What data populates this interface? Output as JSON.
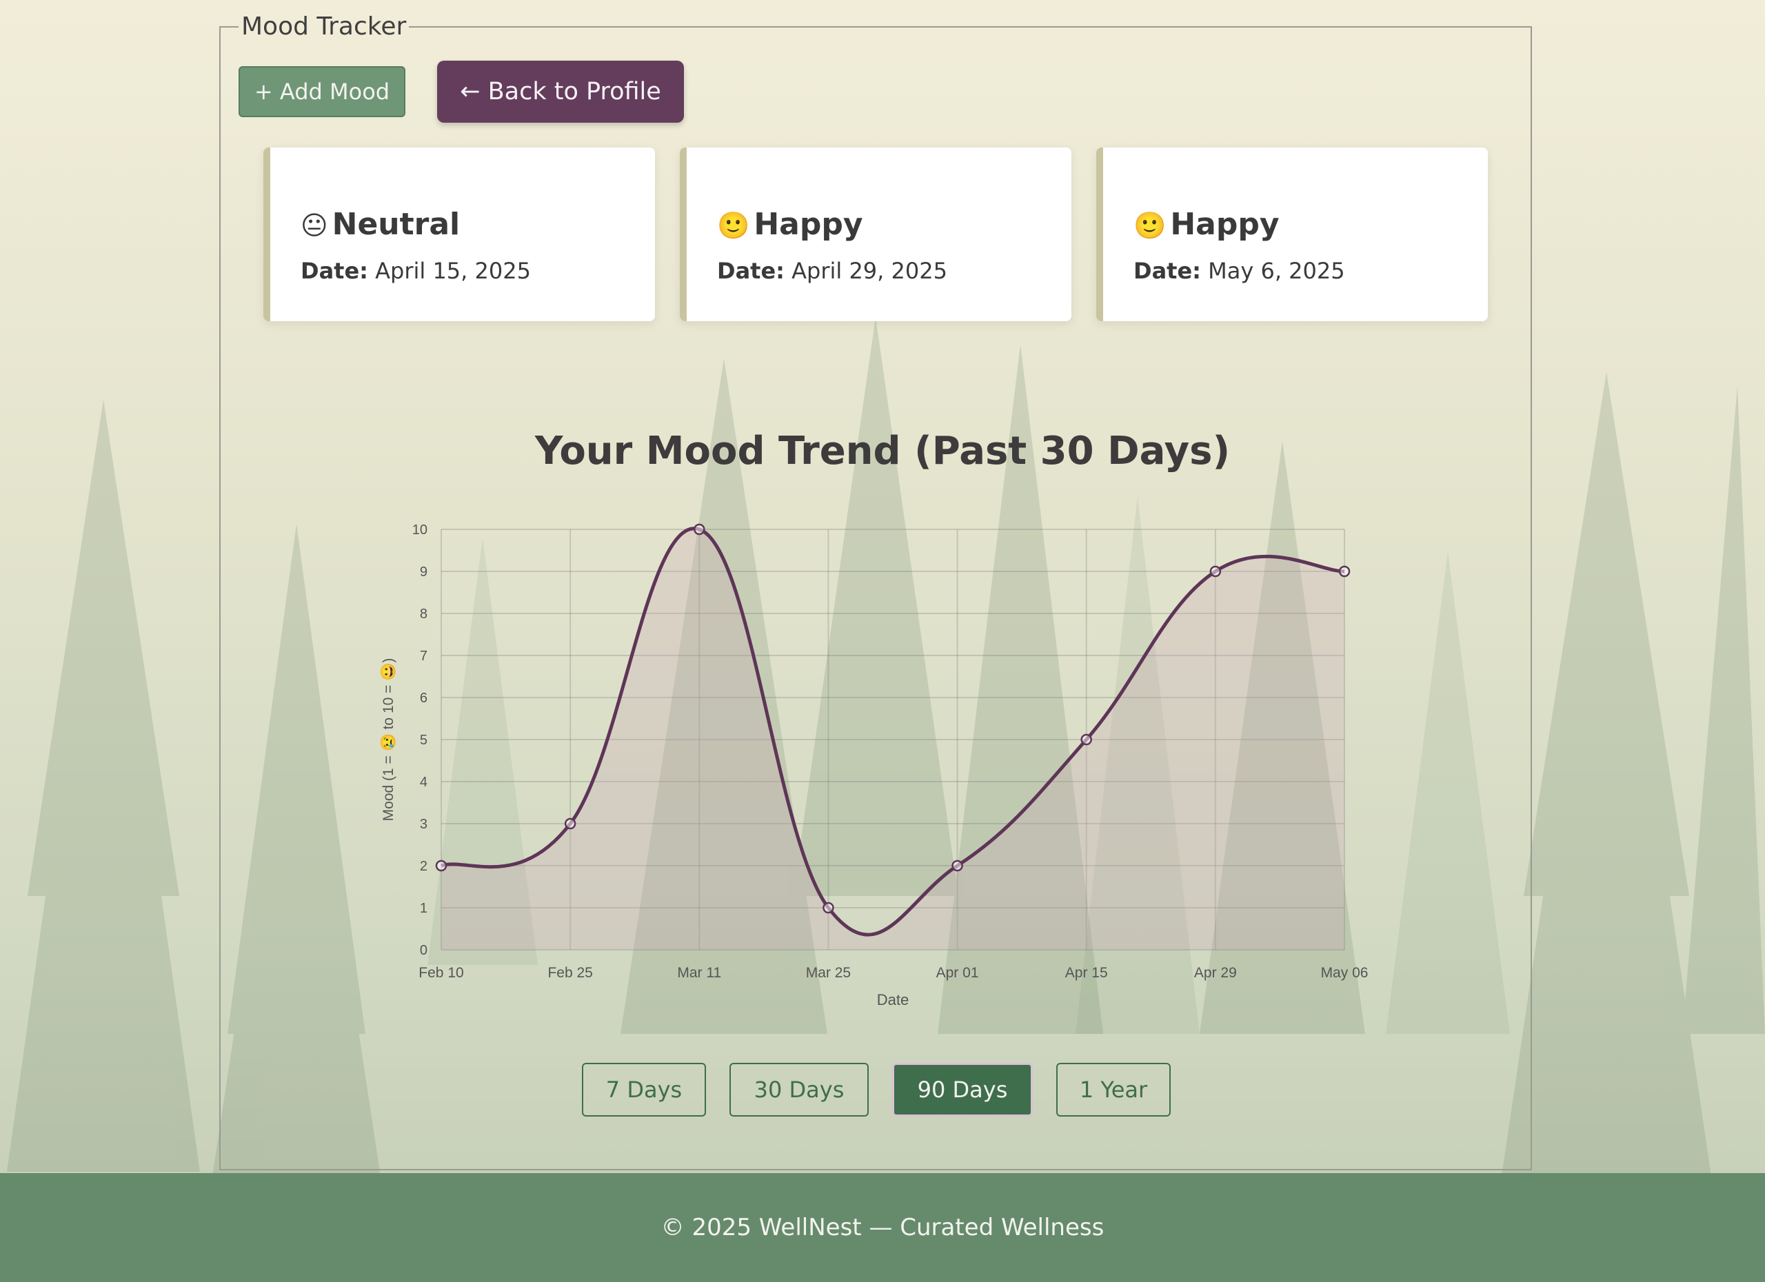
{
  "page": {
    "section_title": "Mood Tracker",
    "add_button": "+ Add Mood",
    "back_button": "← Back to Profile",
    "date_label": "Date:"
  },
  "entries": [
    {
      "emoji": "😐",
      "mood": "Neutral",
      "date": "April 15, 2025"
    },
    {
      "emoji": "🙂",
      "mood": "Happy",
      "date": "April 29, 2025"
    },
    {
      "emoji": "🙂",
      "mood": "Happy",
      "date": "May 6, 2025"
    }
  ],
  "chart_data": {
    "type": "line",
    "title": "Your Mood Trend (Past 30 Days)",
    "xlabel": "Date",
    "ylabel": "Mood (1 = 😢 to 10 = 😀)",
    "ylim": [
      0,
      10
    ],
    "yticks": [
      0,
      1,
      2,
      3,
      4,
      5,
      6,
      7,
      8,
      9,
      10
    ],
    "x": [
      "Feb 10",
      "Feb 25",
      "Mar 11",
      "Mar 25",
      "Apr 01",
      "Apr 15",
      "Apr 29",
      "May 06"
    ],
    "values": [
      2,
      3,
      10,
      1,
      2,
      5,
      9,
      9
    ],
    "grid": true,
    "filled": true,
    "line_color": "#5e3557",
    "fill_color": "#c9aab8"
  },
  "ranges": [
    {
      "label": "7 Days",
      "active": false
    },
    {
      "label": "30 Days",
      "active": false
    },
    {
      "label": "90 Days",
      "active": true
    },
    {
      "label": "1 Year",
      "active": false
    }
  ],
  "footer": {
    "text": "© 2025 WellNest — Curated Wellness"
  },
  "colors": {
    "primary_green": "#3f6e4d",
    "accent_plum": "#633d5b",
    "footer_green": "#668b6c"
  }
}
